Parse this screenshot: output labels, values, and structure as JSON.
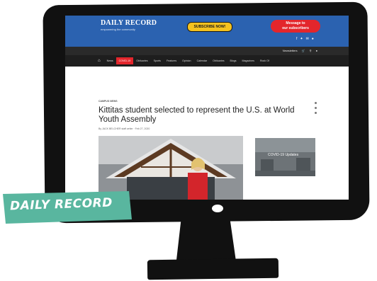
{
  "site": {
    "logo": "DAILY RECORD",
    "logo_tagline": "empowering the community",
    "subscribe_label": "SUBSCRIBE NOW!",
    "message_label_line1": "Message to",
    "message_label_line2": "our subscribers",
    "social_icons": [
      "facebook-icon",
      "twitter-icon",
      "email-icon",
      "rss-icon"
    ]
  },
  "utility": {
    "newsletters_label": "Newsletters"
  },
  "nav": {
    "items": [
      "News",
      "COVID-19",
      "Obituaries",
      "Sports",
      "Features",
      "Opinion",
      "Calendar",
      "Obituaries",
      "Blogs",
      "Magazines",
      "Rock Of"
    ]
  },
  "article": {
    "category": "CAMPUS NEWS",
    "title": "Kittitas student selected to represent the U.S. at World Youth Assembly",
    "byline": "By JACK BELCHER staff writer · Feb 27, 2020",
    "side_image_label": "COVID-19 Updates"
  },
  "badge": {
    "text": "DAILY RECORD",
    "color": "#59b69f"
  },
  "colors": {
    "header_blue": "#2b62b0",
    "nav_dark": "#1e1e1e",
    "subscribe_yellow": "#f4c21f",
    "accent_red": "#e3262c"
  }
}
